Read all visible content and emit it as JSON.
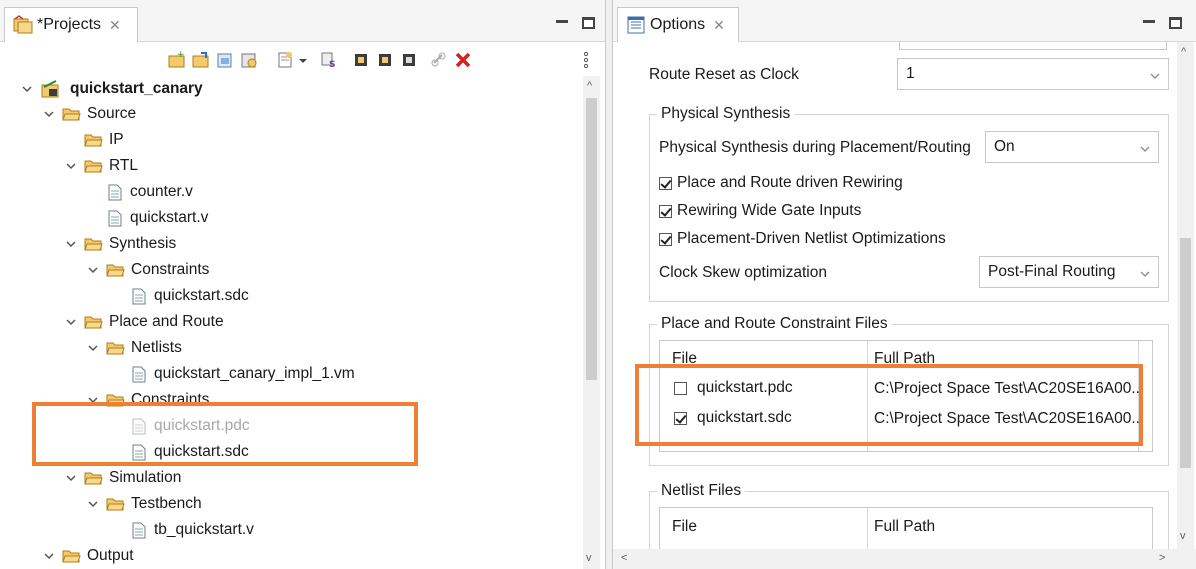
{
  "projects_panel": {
    "tab_title": "*Projects",
    "tree": {
      "project": "quickstart_canary",
      "source": "Source",
      "ip": "IP",
      "rtl": "RTL",
      "counter_v": "counter.v",
      "quickstart_v": "quickstart.v",
      "synthesis": "Synthesis",
      "synth_constraints": "Constraints",
      "synth_sdc": "quickstart.sdc",
      "place_route": "Place and Route",
      "netlists": "Netlists",
      "netlist_vm": "quickstart_canary_impl_1.vm",
      "pr_constraints": "Constraints",
      "pr_pdc": "quickstart.pdc",
      "pr_sdc": "quickstart.sdc",
      "simulation": "Simulation",
      "testbench": "Testbench",
      "tb_file": "tb_quickstart.v",
      "output": "Output"
    }
  },
  "options_panel": {
    "tab_title": "Options",
    "route_reset_label": "Route Reset as Clock",
    "route_reset_value": "1",
    "physical_synthesis": {
      "title": "Physical Synthesis",
      "during_label": "Physical Synthesis during Placement/Routing",
      "during_value": "On",
      "rewiring_label": "Place and Route driven Rewiring",
      "rewiring_checked": true,
      "wide_gate_label": "Rewiring Wide Gate Inputs",
      "wide_gate_checked": true,
      "netlist_opt_label": "Placement-Driven Netlist Optimizations",
      "netlist_opt_checked": true,
      "clock_skew_label": "Clock Skew optimization",
      "clock_skew_value": "Post-Final Routing"
    },
    "constraint_files": {
      "title": "Place and Route Constraint Files",
      "col_file": "File",
      "col_path": "Full Path",
      "rows": [
        {
          "file": "quickstart.pdc",
          "path": "C:\\Project Space Test\\AC20SE16A00...",
          "checked": false
        },
        {
          "file": "quickstart.sdc",
          "path": "C:\\Project Space Test\\AC20SE16A00...",
          "checked": true
        }
      ]
    },
    "netlist_files": {
      "title": "Netlist Files",
      "col_file": "File",
      "col_path": "Full Path"
    }
  },
  "colors": {
    "highlight": "#ef7f35",
    "folder": "#e8b84a"
  }
}
